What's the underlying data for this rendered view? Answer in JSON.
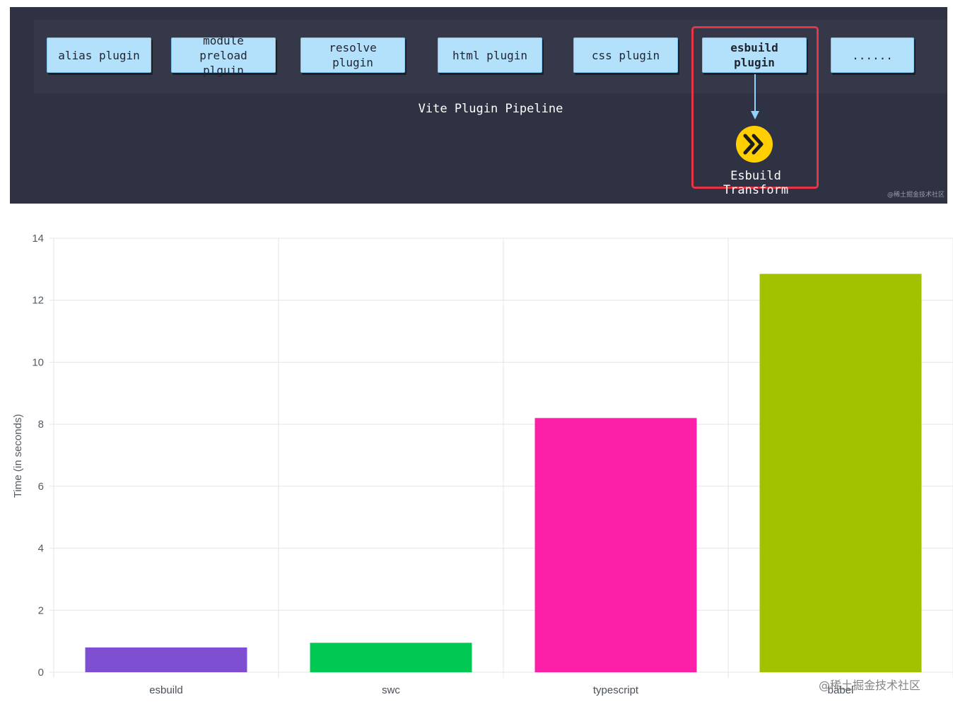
{
  "pipeline": {
    "plugins": [
      {
        "id": "alias",
        "label": "alias plugin"
      },
      {
        "id": "module-preload",
        "label": "module preload\nplguin"
      },
      {
        "id": "resolve",
        "label": "resolve plugin"
      },
      {
        "id": "html",
        "label": "html plugin"
      },
      {
        "id": "css",
        "label": "css plugin"
      },
      {
        "id": "esbuild",
        "label": "esbuild plugin"
      },
      {
        "id": "more",
        "label": "......"
      }
    ],
    "caption": "Vite Plugin Pipeline",
    "transform_label": "Esbuild Transform",
    "logo_icon": "esbuild-double-chevron-icon",
    "highlight_color": "#e63546",
    "plugin_fill": "#b3e0fb",
    "background": "#2f3242"
  },
  "watermark_credit_top": "@稀土掘金技术社区",
  "chart_data": {
    "type": "bar",
    "categories": [
      "esbuild",
      "swc",
      "typescript",
      "babel"
    ],
    "values": [
      0.8,
      0.95,
      8.2,
      12.85
    ],
    "colors": [
      "#7e4fd0",
      "#00c853",
      "#fc1fa7",
      "#a2c200"
    ],
    "ylabel": "Time (in seconds)",
    "xlabel": "",
    "ylim": [
      0,
      14
    ],
    "yticks": [
      0,
      2,
      4,
      6,
      8,
      10,
      12,
      14
    ],
    "grid": true
  },
  "watermark_credit_bottom": "@稀土掘金技术社区"
}
